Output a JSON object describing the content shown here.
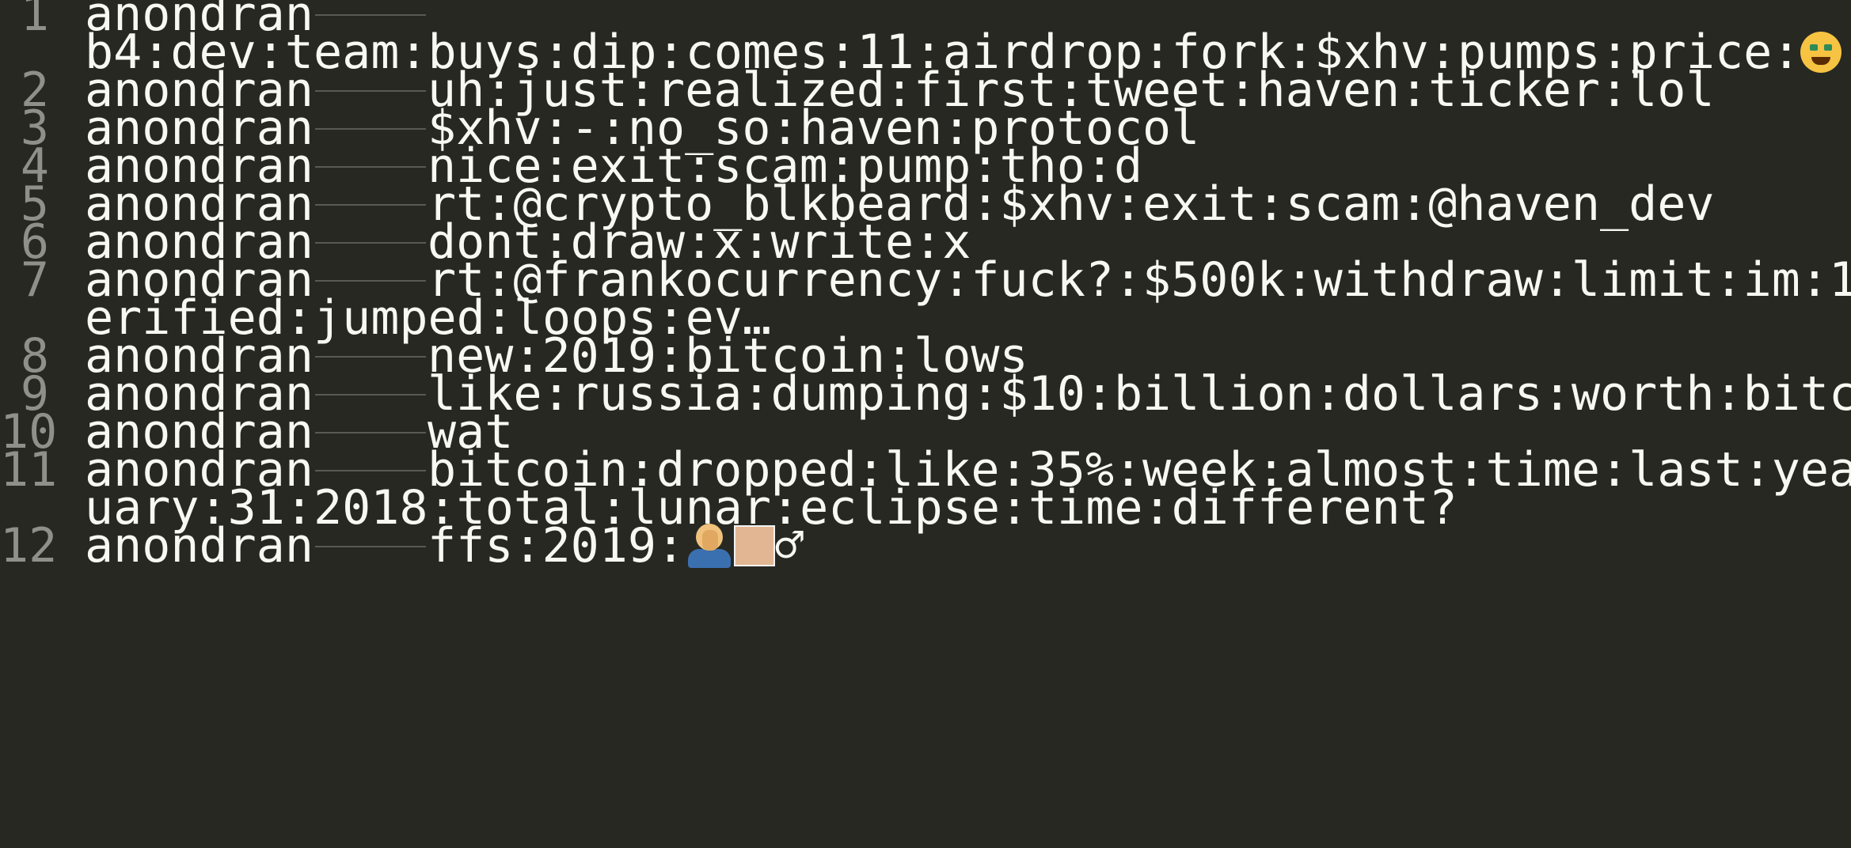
{
  "editor": {
    "lines": [
      {
        "number": "1",
        "user": "anondran",
        "text": "",
        "wrap": "b4:dev:team:buys:dip:comes:11:airdrop:fork:$xhv:pumps:price:"
      },
      {
        "number": "2",
        "user": "anondran",
        "text": "uh:just:realized:first:tweet:haven:ticker:lol"
      },
      {
        "number": "3",
        "user": "anondran",
        "text": "$xhv:-:no_so:haven:protocol"
      },
      {
        "number": "4",
        "user": "anondran",
        "text": "nice:exit:scam:pump:tho:d"
      },
      {
        "number": "5",
        "user": "anondran",
        "text": "rt:@crypto_blkbeard:$xhv:exit:scam:@haven_dev"
      },
      {
        "number": "6",
        "user": "anondran",
        "text": "dont:draw:x:write:x"
      },
      {
        "number": "7",
        "user": "anondran",
        "text": "rt:@frankocurrency:fuck?:$500k:withdraw:limit:im:1",
        "wrap": "erified:jumped:loops:ev…"
      },
      {
        "number": "8",
        "user": "anondran",
        "text": "new:2019:bitcoin:lows"
      },
      {
        "number": "9",
        "user": "anondran",
        "text": "like:russia:dumping:$10:billion:dollars:worth:bitc"
      },
      {
        "number": "10",
        "user": "anondran",
        "text": "wat"
      },
      {
        "number": "11",
        "user": "anondran",
        "text": "bitcoin:dropped:like:35%:week:almost:time:last:yea",
        "wrap": "uary:31:2018:total:lunar:eclipse:time:different?"
      },
      {
        "number": "12",
        "user": "anondran",
        "text": "ffs:2019:",
        "trail": "♂"
      }
    ],
    "icons": {
      "line1_emoji": "money-mouth-face-icon",
      "line12_emoji": "man-facepalming-icon",
      "line12_swatch": "skin-tone-swatch-icon"
    },
    "colors": {
      "background": "#272822",
      "text": "#f8f8f2",
      "gutter": "#90908a",
      "tab_marker": "#5a5a55"
    }
  }
}
